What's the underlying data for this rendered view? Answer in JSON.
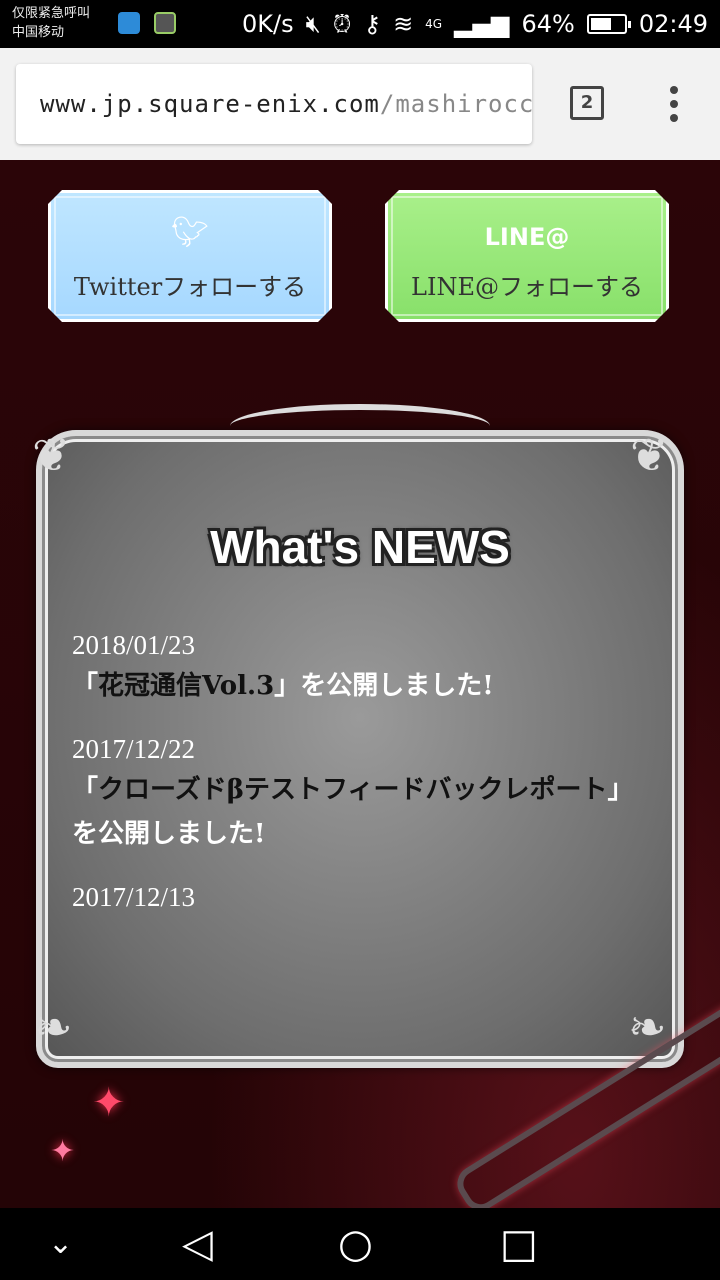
{
  "status_bar": {
    "carrier_line1": "仅限紧急呼叫",
    "carrier_line2": "中国移动",
    "net_speed": "0K/s",
    "network": "4G",
    "battery": "64%",
    "battery_level": 0.64,
    "time": "02:49"
  },
  "browser": {
    "url_host": "www.jp.square-enix.com",
    "url_path": "/mashirocc",
    "tab_count": "2"
  },
  "page": {
    "twitter_button": "Twitterフォローする",
    "line_button_logo": "LINE@",
    "line_button": "LINE@フォローする",
    "news_title": "What's NEWS",
    "news": [
      {
        "date": "2018/01/23",
        "quote_open": "「",
        "highlight": "花冠通信Vol.3",
        "quote_close": "」",
        "text": "を公開しました!"
      },
      {
        "date": "2017/12/22",
        "quote_open": "「",
        "highlight": "クローズドβテストフィードバックレポート",
        "quote_close": "」",
        "text": "を公開しました!"
      },
      {
        "date": "2017/12/13"
      }
    ]
  },
  "colors": {
    "page_bg": "#2b0508",
    "twitter_bg": "#a6d8ff",
    "line_bg": "#88e06a"
  }
}
